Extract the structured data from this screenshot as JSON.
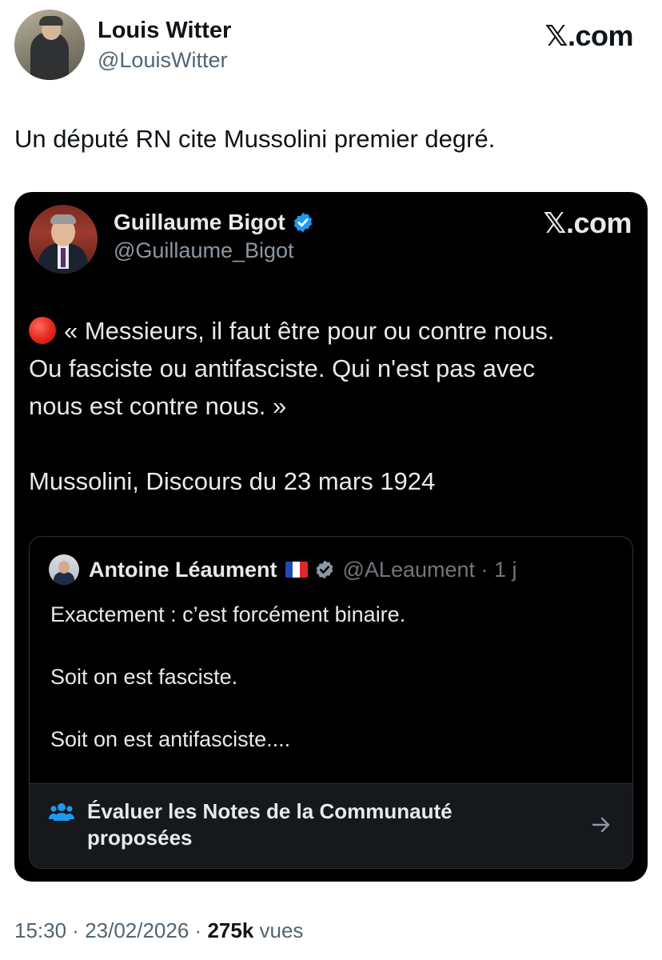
{
  "outer_tweet": {
    "author_name": "Louis Witter",
    "author_handle": "@LouisWitter",
    "brand": "𝕏.com",
    "text": "Un député RN cite Mussolini premier degré."
  },
  "embedded_tweet": {
    "author_name": "Guillaume Bigot",
    "author_handle": "@Guillaume_Bigot",
    "brand": "𝕏.com",
    "verified_icon": "verified-badge-icon",
    "lines": [
      "« Messieurs, il faut être pour ou contre nous.",
      "Ou fasciste ou antifasciste. Qui n'est pas avec",
      "nous est contre nous. »",
      "Mussolini, Discours du 23 mars 1924"
    ],
    "quoted_tweet": {
      "author_name": "Antoine Léaument",
      "author_handle": "@ALeaument · 1 j",
      "lines": [
        "Exactement : c’est forcément binaire.",
        "Soit on est fasciste.",
        "Soit on est antifasciste...."
      ]
    },
    "community_notes": {
      "label_line1": "Évaluer les Notes de la Communauté",
      "label_line2": "proposées",
      "icon": "people-icon",
      "arrow_icon": "arrow-right-icon"
    }
  },
  "footer": {
    "time": "15:30",
    "separator": " · ",
    "date": "23/02/2026",
    "separator2": " · ",
    "views_count": "275k",
    "views_label": " vues"
  },
  "colors": {
    "verified_blue": "#1d9bf0",
    "dark_card_bg": "#000000",
    "muted_text": "#536471",
    "notes_icon_blue": "#1d9bf0"
  }
}
